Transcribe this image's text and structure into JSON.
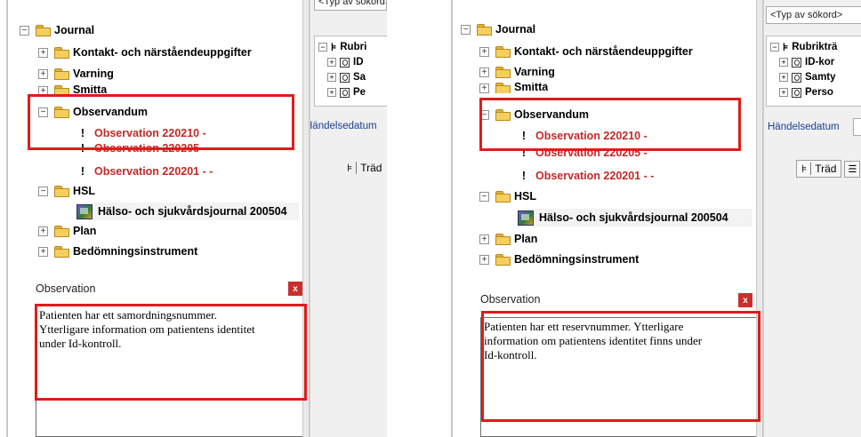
{
  "panels": [
    {
      "tree": {
        "journal": "Journal",
        "kontakt": "Kontakt- och närståendeuppgifter",
        "varning": "Varning",
        "smitta": "Smitta",
        "observandum": "Observandum",
        "obs1": "Observation 220210 -",
        "obs2": "Observation 220205 -",
        "obs3": "Observation 220201 - -",
        "hsl": "HSL",
        "halso": "Hälso- och sjukvårdsjournal 200504",
        "plan": "Plan",
        "bedomning": "Bedömningsinstrument"
      },
      "right": {
        "search_placeholder": "<Typ av sökord>",
        "rubrik": "Rubri",
        "r1": "ID",
        "r2": "Sa",
        "r3": "Pe",
        "handelse": "Händelsedatum",
        "trad": "Träd"
      },
      "observation": {
        "title": "Observation",
        "close": "x",
        "text_lines": [
          "Patienten har ett samordningsnummer.",
          "Ytterligare information om patientens identitet",
          "under Id-kontroll."
        ]
      }
    },
    {
      "tree": {
        "journal": "Journal",
        "kontakt": "Kontakt- och närståendeuppgifter",
        "varning": "Varning",
        "smitta": "Smitta",
        "observandum": "Observandum",
        "obs1": "Observation 220210 -",
        "obs2": "Observation 220205 -",
        "obs3": "Observation 220201 - -",
        "hsl": "HSL",
        "halso": "Hälso- och sjukvårdsjournal 200504",
        "plan": "Plan",
        "bedomning": "Bedömningsinstrument"
      },
      "right": {
        "search_placeholder": "<Typ av sökord>",
        "rubrik": "Rubrikträ",
        "r1": "ID-kor",
        "r2": "Samty",
        "r3": "Perso",
        "handelse": "Händelsedatum",
        "trad": "Träd"
      },
      "observation": {
        "title": "Observation",
        "close": "x",
        "text_lines": [
          "Patienten har ett reservnummer. Ytterligare",
          "information om patientens identitet finns under",
          "Id-kontroll."
        ]
      }
    }
  ],
  "colors": {
    "highlight_box": "#e01b1b",
    "observation_text": "#c62828",
    "folder": "#f5cf5d",
    "link_blue": "#1a3f8f"
  }
}
